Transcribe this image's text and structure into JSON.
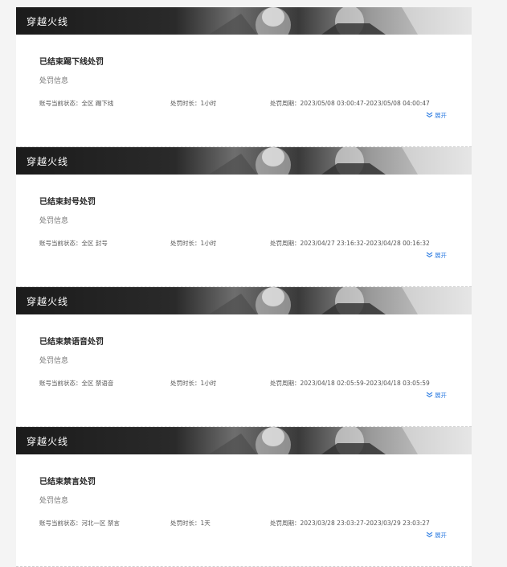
{
  "records": [
    {
      "game": "穿越火线",
      "title": "已结束踢下线处罚",
      "info_label": "处罚信息",
      "status": "账号当前状态：全区 踢下线",
      "duration": "处罚时长：1小时",
      "period": "处罚周期：2023/05/08 03:00:47-2023/05/08 04:00:47",
      "expand": "展开"
    },
    {
      "game": "穿越火线",
      "title": "已结束封号处罚",
      "info_label": "处罚信息",
      "status": "账号当前状态：全区 封号",
      "duration": "处罚时长：1小时",
      "period": "处罚周期：2023/04/27 23:16:32-2023/04/28 00:16:32",
      "expand": "展开"
    },
    {
      "game": "穿越火线",
      "title": "已结束禁语音处罚",
      "info_label": "处罚信息",
      "status": "账号当前状态：全区 禁语音",
      "duration": "处罚时长：1小时",
      "period": "处罚周期：2023/04/18 02:05:59-2023/04/18 03:05:59",
      "expand": "展开"
    },
    {
      "game": "穿越火线",
      "title": "已结束禁言处罚",
      "info_label": "处罚信息",
      "status": "账号当前状态：河北一区 禁言",
      "duration": "处罚时长：1天",
      "period": "处罚周期：2023/03/28 23:03:27-2023/03/29 23:03:27",
      "expand": "展开"
    }
  ],
  "colors": {
    "link": "#2f7de1",
    "title": "#222222",
    "banner_text": "#ffffff"
  }
}
